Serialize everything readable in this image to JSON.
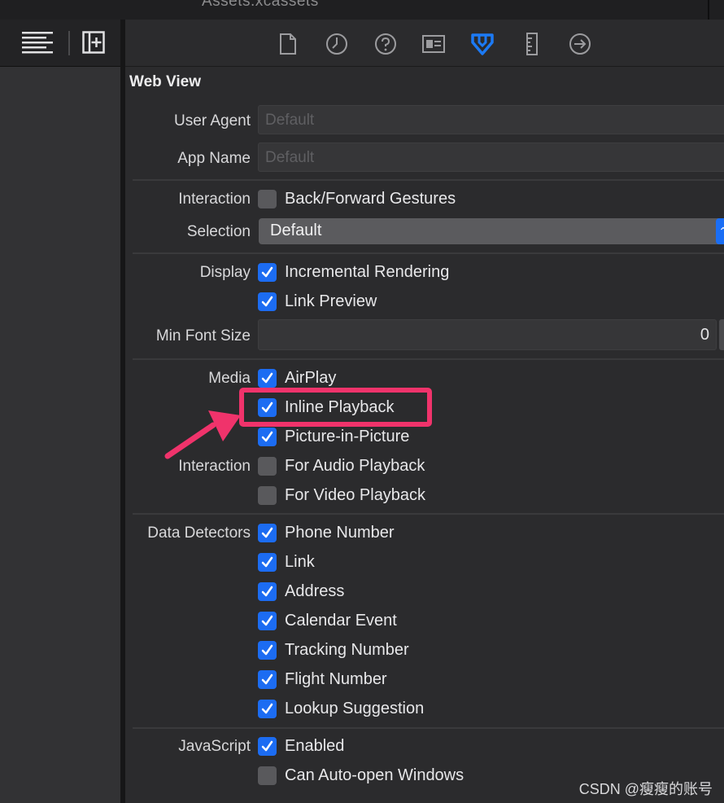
{
  "topbar": {
    "file_name": "Assets.xcassets"
  },
  "toolbar_left": {
    "icons": [
      "text-align-left-icon",
      "add-editor-icon"
    ]
  },
  "inspector_tabs": [
    {
      "icon": "file-icon",
      "active": false
    },
    {
      "icon": "history-clock-icon",
      "active": false
    },
    {
      "icon": "help-circle-icon",
      "active": false
    },
    {
      "icon": "identity-card-icon",
      "active": false
    },
    {
      "icon": "attributes-arrow-down-icon",
      "active": true
    },
    {
      "icon": "ruler-icon",
      "active": false
    },
    {
      "icon": "connections-arrow-icon",
      "active": false
    }
  ],
  "section": {
    "title": "Web View"
  },
  "user_agent": {
    "label": "User Agent",
    "placeholder": "Default"
  },
  "app_name": {
    "label": "App Name",
    "placeholder": "Default"
  },
  "interaction": {
    "label": "Interaction",
    "back_forward": {
      "text": "Back/Forward Gestures",
      "checked": false
    }
  },
  "selection": {
    "label": "Selection",
    "value": "Default"
  },
  "display": {
    "label": "Display",
    "incremental": {
      "text": "Incremental Rendering",
      "checked": true
    },
    "link_preview": {
      "text": "Link Preview",
      "checked": true
    }
  },
  "min_font": {
    "label": "Min Font Size",
    "value": "0"
  },
  "media": {
    "label": "Media",
    "airplay": {
      "text": "AirPlay",
      "checked": true
    },
    "inline": {
      "text": "Inline Playback",
      "checked": true
    },
    "pip": {
      "text": "Picture-in-Picture",
      "checked": true
    }
  },
  "media_interaction": {
    "label": "Interaction",
    "audio": {
      "text": "For Audio Playback",
      "checked": false
    },
    "video": {
      "text": "For Video Playback",
      "checked": false
    }
  },
  "data_detectors": {
    "label": "Data Detectors",
    "phone": {
      "text": "Phone Number",
      "checked": true
    },
    "link": {
      "text": "Link",
      "checked": true
    },
    "address": {
      "text": "Address",
      "checked": true
    },
    "calendar": {
      "text": "Calendar Event",
      "checked": true
    },
    "tracking": {
      "text": "Tracking Number",
      "checked": true
    },
    "flight": {
      "text": "Flight Number",
      "checked": true
    },
    "lookup": {
      "text": "Lookup Suggestion",
      "checked": true
    }
  },
  "javascript": {
    "label": "JavaScript",
    "enabled": {
      "text": "Enabled",
      "checked": true
    },
    "auto_open": {
      "text": "Can Auto-open Windows",
      "checked": false
    }
  },
  "colors": {
    "accent": "#1c6cf2",
    "highlight": "#f0336b",
    "background": "#2b2b2d"
  },
  "watermark": {
    "text": "CSDN @瘦瘦的账号"
  }
}
